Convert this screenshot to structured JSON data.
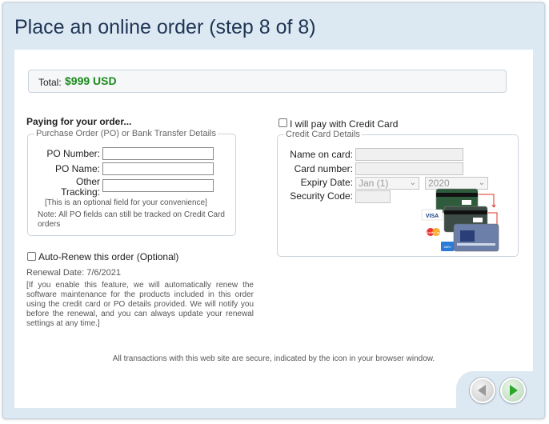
{
  "header": {
    "title": "Place an online order (step 8 of 8)"
  },
  "total": {
    "label": "Total:",
    "value": "$999 USD"
  },
  "paying": {
    "title": "Paying for your order...",
    "po_legend": "Purchase Order (PO) or Bank Transfer Details",
    "po_number_label": "PO Number:",
    "po_name_label": "PO Name:",
    "other_label_1": "Other",
    "other_label_2": "Tracking:",
    "optional_note": "[This is an optional field for your convenience]",
    "note": "Note: All PO fields can still be tracked on Credit Card orders"
  },
  "credit": {
    "checkbox_label": "I will pay with Credit Card",
    "legend": "Credit Card Details",
    "name_label": "Name on card:",
    "number_label": "Card number:",
    "expiry_label": "Expiry Date:",
    "expiry_month": "Jan (1)",
    "expiry_year": "2020",
    "security_label": "Security Code:",
    "card_brands": [
      "VISA",
      "MasterCard",
      "AMEX"
    ]
  },
  "renew": {
    "checkbox_label": "Auto-Renew this order (Optional)",
    "date": "Renewal Date: 7/6/2021",
    "description": "[If you enable this feature, we will automatically renew the software maintenance for the products included in this order using the credit card or PO details provided. We will notify you before the renewal, and you can always update your renewal settings at any time.]"
  },
  "footer": {
    "secure_note": "All transactions with this web site are secure, indicated by the icon in your browser window."
  },
  "colors": {
    "total": "#1a8a1a",
    "title": "#1f3554",
    "panel_bg": "#dce8f2",
    "next": "#2aa82a",
    "prev": "#9a9a9a"
  },
  "icons": {
    "prev": "arrow-left-circle-icon",
    "next": "arrow-right-circle-icon"
  }
}
